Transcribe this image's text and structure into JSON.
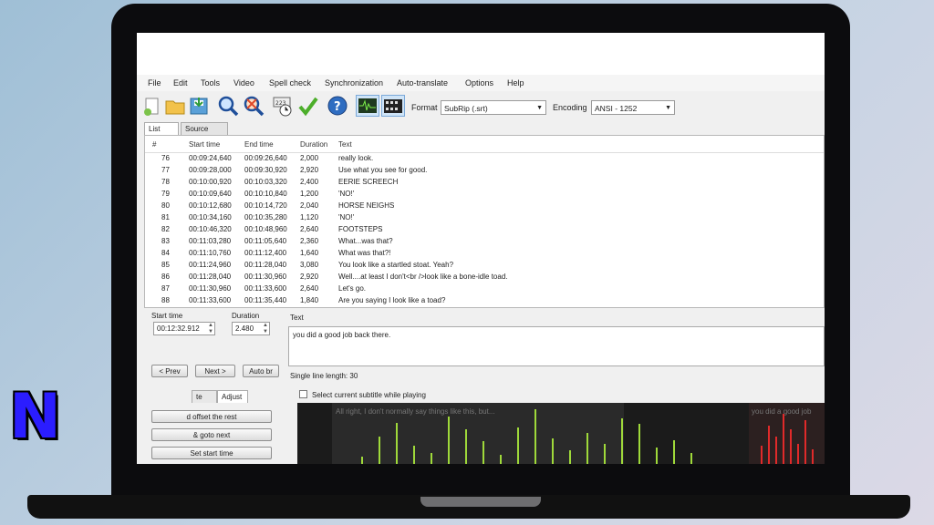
{
  "menu": [
    "File",
    "Edit",
    "Tools",
    "Video",
    "Spell check",
    "Synchronization",
    "Auto-translate",
    "Options",
    "Help"
  ],
  "toolbar": {
    "format_label": "Format",
    "format_value": "SubRip (.srt)",
    "encoding_label": "Encoding",
    "encoding_value": "ANSI - 1252",
    "icons": [
      "new-file-icon",
      "open-folder-icon",
      "save-icon",
      "find-icon",
      "replace-icon",
      "visual-sync-icon",
      "spell-check-icon",
      "help-icon",
      "waveform-toggle-icon",
      "video-toggle-icon"
    ]
  },
  "tabs": [
    "List view",
    "Source view"
  ],
  "grid": {
    "columns": [
      "#",
      "Start time",
      "End time",
      "Duration",
      "Text"
    ],
    "rows": [
      [
        "76",
        "00:09:24,640",
        "00:09:26,640",
        "2,000",
        "really look."
      ],
      [
        "77",
        "00:09:28,000",
        "00:09:30,920",
        "2,920",
        "Use what you see for good."
      ],
      [
        "78",
        "00:10:00,920",
        "00:10:03,320",
        "2,400",
        "EERIE SCREECH"
      ],
      [
        "79",
        "00:10:09,640",
        "00:10:10,840",
        "1,200",
        "'NO!'"
      ],
      [
        "80",
        "00:10:12,680",
        "00:10:14,720",
        "2,040",
        "HORSE NEIGHS"
      ],
      [
        "81",
        "00:10:34,160",
        "00:10:35,280",
        "1,120",
        "'NO!'"
      ],
      [
        "82",
        "00:10:46,320",
        "00:10:48,960",
        "2,640",
        "FOOTSTEPS"
      ],
      [
        "83",
        "00:11:03,280",
        "00:11:05,640",
        "2,360",
        "What...was that?"
      ],
      [
        "84",
        "00:11:10,760",
        "00:11:12,400",
        "1,640",
        "What was that?!"
      ],
      [
        "85",
        "00:11:24,960",
        "00:11:28,040",
        "3,080",
        "You look like a startled stoat. Yeah?"
      ],
      [
        "86",
        "00:11:28,040",
        "00:11:30,960",
        "2,920",
        "Well....at least I don't<br />look like a bone-idle toad."
      ],
      [
        "87",
        "00:11:30,960",
        "00:11:33,600",
        "2,640",
        "Let's go."
      ],
      [
        "88",
        "00:11:33,600",
        "00:11:35,440",
        "1,840",
        "Are you saying I look like a toad?"
      ]
    ]
  },
  "editor": {
    "start_label": "Start time",
    "start_value": "00:12:32.912",
    "duration_label": "Duration",
    "duration_value": "2.480",
    "text_label": "Text",
    "text_value": "you did a good job back there.",
    "prev_label": "< Prev",
    "next_label": "Next >",
    "autobr_label": "Auto br",
    "line_length": "Single line length: 30"
  },
  "bottom": {
    "tab_create": "te",
    "tab_adjust": "Adjust",
    "select_while_playing": "Select current subtitle while playing",
    "btn1": "d offset the rest",
    "btn2": "& goto next",
    "btn3": "Set start time",
    "wave_text_1": "All right, I don't normally say things like this, but...",
    "wave_text_2": "you did a good job"
  },
  "logo_letter": "N"
}
